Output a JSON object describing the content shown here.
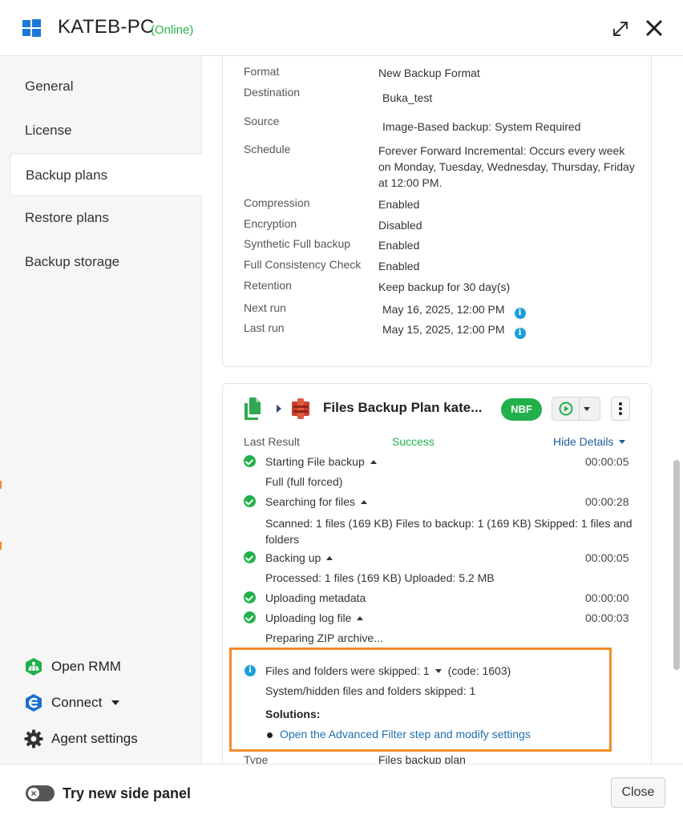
{
  "header": {
    "title": "KATEB-PC",
    "status": "(Online)",
    "icons": {
      "os": "windows-logo",
      "expand": "expand-icon",
      "close": "close-icon"
    }
  },
  "sidebar": {
    "items": [
      {
        "label": "General",
        "active": false
      },
      {
        "label": "License",
        "active": false
      },
      {
        "label": "Backup plans",
        "active": true
      },
      {
        "label": "Restore plans",
        "active": false
      },
      {
        "label": "Backup storage",
        "active": false
      }
    ],
    "bottom": [
      {
        "label": "Open RMM",
        "icon": "rmm-icon"
      },
      {
        "label": "Connect",
        "icon": "connect-icon"
      },
      {
        "label": "Agent settings",
        "icon": "gear-icon"
      }
    ]
  },
  "plan1": {
    "rows": [
      {
        "key": "Format",
        "value": "New Backup Format"
      },
      {
        "key": "Destination",
        "value": "Buka_test"
      },
      {
        "key": "Source",
        "value": "Image-Based backup: System Required"
      },
      {
        "key": "Schedule",
        "value": "Forever Forward Incremental: Occurs every week on Monday, Tuesday, Wednesday, Thursday, Friday at 12:00 PM."
      },
      {
        "key": "Compression",
        "value": "Enabled"
      },
      {
        "key": "Encryption",
        "value": "Disabled"
      },
      {
        "key": "Synthetic Full backup",
        "value": "Enabled"
      },
      {
        "key": "Full Consistency Check",
        "value": "Enabled"
      },
      {
        "key": "Retention",
        "value": "Keep backup for 30 day(s)"
      },
      {
        "key": "Next run",
        "value": "May 16, 2025, 12:00 PM"
      },
      {
        "key": "Last run",
        "value": "May 15, 2025, 12:00 PM"
      }
    ]
  },
  "plan2": {
    "title": "Files Backup Plan kate...",
    "format_badge": "NBF",
    "last_result_label": "Last Result",
    "last_result_value": "Success",
    "hide_details": "Hide Details",
    "steps": [
      {
        "name": "Starting File backup",
        "time": "00:00:05",
        "detail": "Full (full forced)"
      },
      {
        "name": "Searching for files",
        "time": "00:00:28",
        "detail": "Scanned: 1 files (169 KB) Files to backup: 1 (169 KB) Skipped: 1 files and folders"
      },
      {
        "name": "Backing up",
        "time": "00:00:05",
        "detail": "Processed: 1 files (169 KB) Uploaded: 5.2 MB"
      },
      {
        "name": "Uploading metadata",
        "time": "00:00:00",
        "detail": ""
      },
      {
        "name": "Uploading log file",
        "time": "00:00:03",
        "detail": "Preparing ZIP archive..."
      }
    ],
    "warning": {
      "title": "Files and folders were skipped: 1",
      "code": "(code: 1603)",
      "detail": "System/hidden files and folders skipped: 1",
      "solutions_label": "Solutions:",
      "solution_link": "Open the Advanced Filter step and modify settings"
    },
    "type_key": "Type",
    "type_value": "Files backup plan"
  },
  "footer": {
    "toggle_label": "Try new side panel",
    "close_label": "Close"
  },
  "colors": {
    "online": "#2bb24c",
    "success": "#21b04b",
    "link": "#1f6fb0",
    "highlight": "#f28c28",
    "info": "#1a9fd9"
  }
}
